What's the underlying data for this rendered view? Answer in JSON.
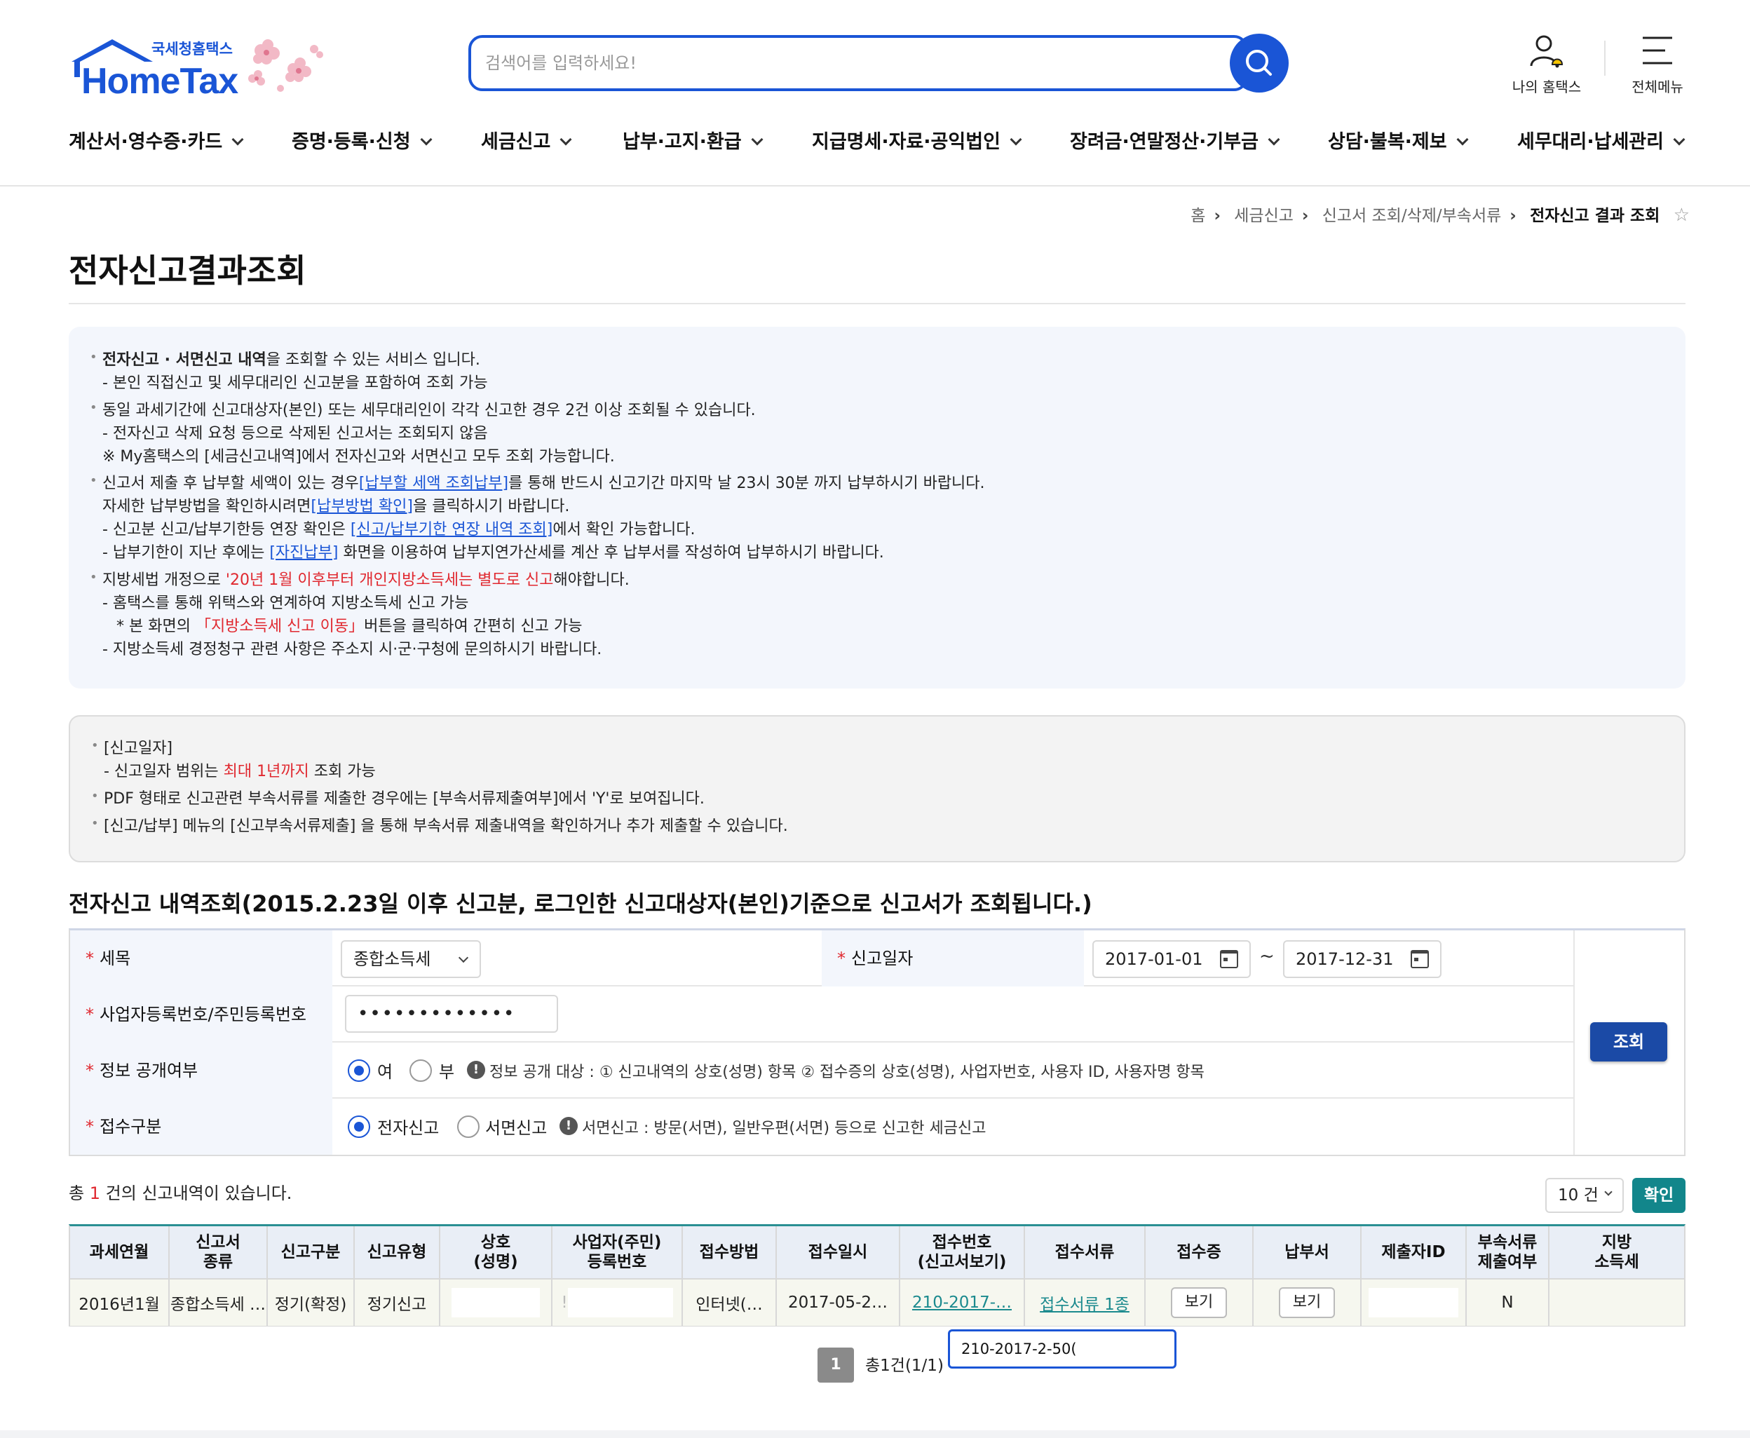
{
  "header": {
    "logo_kr": "국세청홈택스",
    "logo_en": "HomeTax",
    "search_placeholder": "검색어를 입력하세요!",
    "my_hometax": "나의 홈택스",
    "all_menu": "전체메뉴"
  },
  "nav": [
    "계산서·영수증·카드",
    "증명·등록·신청",
    "세금신고",
    "납부·고지·환급",
    "지급명세·자료·공익법인",
    "장려금·연말정산·기부금",
    "상담·불복·제보",
    "세무대리·납세관리"
  ],
  "breadcrumb": {
    "home": "홈",
    "level1": "세금신고",
    "level2": "신고서 조회/삭제/부속서류",
    "current": "전자신고 결과 조회"
  },
  "page_title": "전자신고결과조회",
  "notice1": {
    "l1_bold": "전자신고 · 서면신고 내역",
    "l1_rest": "을 조회할 수 있는 서비스 입니다.",
    "l2": "- 본인 직접신고 및 세무대리인 신고분을 포함하여 조회 가능",
    "l3": "동일 과세기간에 신고대상자(본인) 또는 세무대리인이 각각 신고한 경우 2건 이상 조회될 수 있습니다.",
    "l4": "- 전자신고 삭제 요청 등으로 삭제된 신고서는 조회되지 않음",
    "l5": "※ My홈택스의 [세금신고내역]에서 전자신고와 서면신고 모두 조회 가능합니다.",
    "l6_a": "신고서 제출 후 납부할 세액이 있는 경우",
    "l6_link": "[납부할 세액 조회납부]",
    "l6_b": "를 통해 반드시 신고기간 마지막 날 23시 30분 까지 납부하시기 바랍니다.",
    "l7_a": "자세한 납부방법을 확인하시려면",
    "l7_link": "[납부방법 확인]",
    "l7_b": "을 클릭하시기 바랍니다.",
    "l8_a": "- 신고분 신고/납부기한등 연장 확인은 ",
    "l8_link": "[신고/납부기한 연장 내역 조회]",
    "l8_b": "에서 확인 가능합니다.",
    "l9_a": "- 납부기한이 지난 후에는 ",
    "l9_link": "[자진납부]",
    "l9_b": " 화면을 이용하여 납부지연가산세를 계산 후 납부서를 작성하여 납부하시기 바랍니다.",
    "l10_a": "지방세법 개정으로 ",
    "l10_red": "'20년 1월 이후부터 개인지방소득세는 별도로 신고",
    "l10_b": "해야합니다.",
    "l11": "- 홈택스를 통해 위택스와 연계하여 지방소득세 신고 가능",
    "l12_a": "* 본 화면의 ",
    "l12_red": "「지방소득세 신고 이동」",
    "l12_b": "버튼을 클릭하여 간편히 신고 가능",
    "l13": "- 지방소득세 경정청구 관련 사항은 주소지 시·군·구청에 문의하시기 바랍니다."
  },
  "notice2": {
    "l1": "[신고일자]",
    "l2_a": "- 신고일자 범위는 ",
    "l2_red": "최대 1년까지",
    "l2_b": " 조회 가능",
    "l3": "PDF 형태로 신고관련 부속서류를 제출한 경우에는 [부속서류제출여부]에서 'Y'로 보여집니다.",
    "l4": "[신고/납부] 메뉴의 [신고부속서류제출] 을 통해 부속서류 제출내역을 확인하거나 추가 제출할 수 있습니다."
  },
  "section_title": "전자신고 내역조회(2015.2.23일 이후 신고분, 로그인한  신고대상자(본인)기준으로  신고서가 조회됩니다.)",
  "form": {
    "tax_item_label": "세목",
    "tax_item_value": "종합소득세",
    "report_date_label": "신고일자",
    "date_from": "2017-01-01",
    "date_sep": "~",
    "date_to": "2017-12-31",
    "id_label": "사업자등록번호/주민등록번호",
    "id_value": "•••••••••••••",
    "disclose_label": "정보 공개여부",
    "disclose_yes": "여",
    "disclose_no": "부",
    "disclose_info": "정보 공개 대상 : ① 신고내역의 상호(성명) 항목 ② 접수증의 상호(성명), 사업자번호, 사용자 ID, 사용자명 항목",
    "receipt_label": "접수구분",
    "receipt_e": "전자신고",
    "receipt_paper": "서면신고",
    "receipt_info": "서면신고 : 방문(서면), 일반우편(서면) 등으로 신고한 세금신고",
    "info_glyph": "!",
    "query_btn": "조회"
  },
  "results": {
    "total_prefix": "총",
    "total_count": "1",
    "total_suffix": "건의 신고내역이 있습니다.",
    "page_size": "10 건",
    "confirm_btn": "확인",
    "headers": [
      "과세연월",
      "신고서\n종류",
      "신고구분",
      "신고유형",
      "상호\n(성명)",
      "사업자(주민)\n등록번호",
      "접수방법",
      "접수일시",
      "접수번호\n(신고서보기)",
      "접수서류",
      "접수증",
      "납부서",
      "제출자ID",
      "부속서류\n제출여부",
      "지방\n소득세"
    ],
    "row": {
      "period": "2016년1월",
      "type": "종합소득세 …",
      "category": "정기(확정)",
      "kind": "정기신고",
      "bizno_prefix": "!",
      "method": "인터넷(…",
      "datetime": "2017-05-2…",
      "receipt_no": "210-2017-…",
      "docs": "접수서류 1종",
      "receipt_btn": "보기",
      "payment_btn": "보기",
      "attach": "N"
    },
    "page_number": "1",
    "page_total": "총1건(1/1)",
    "tooltip": "210-2017-2-50("
  }
}
